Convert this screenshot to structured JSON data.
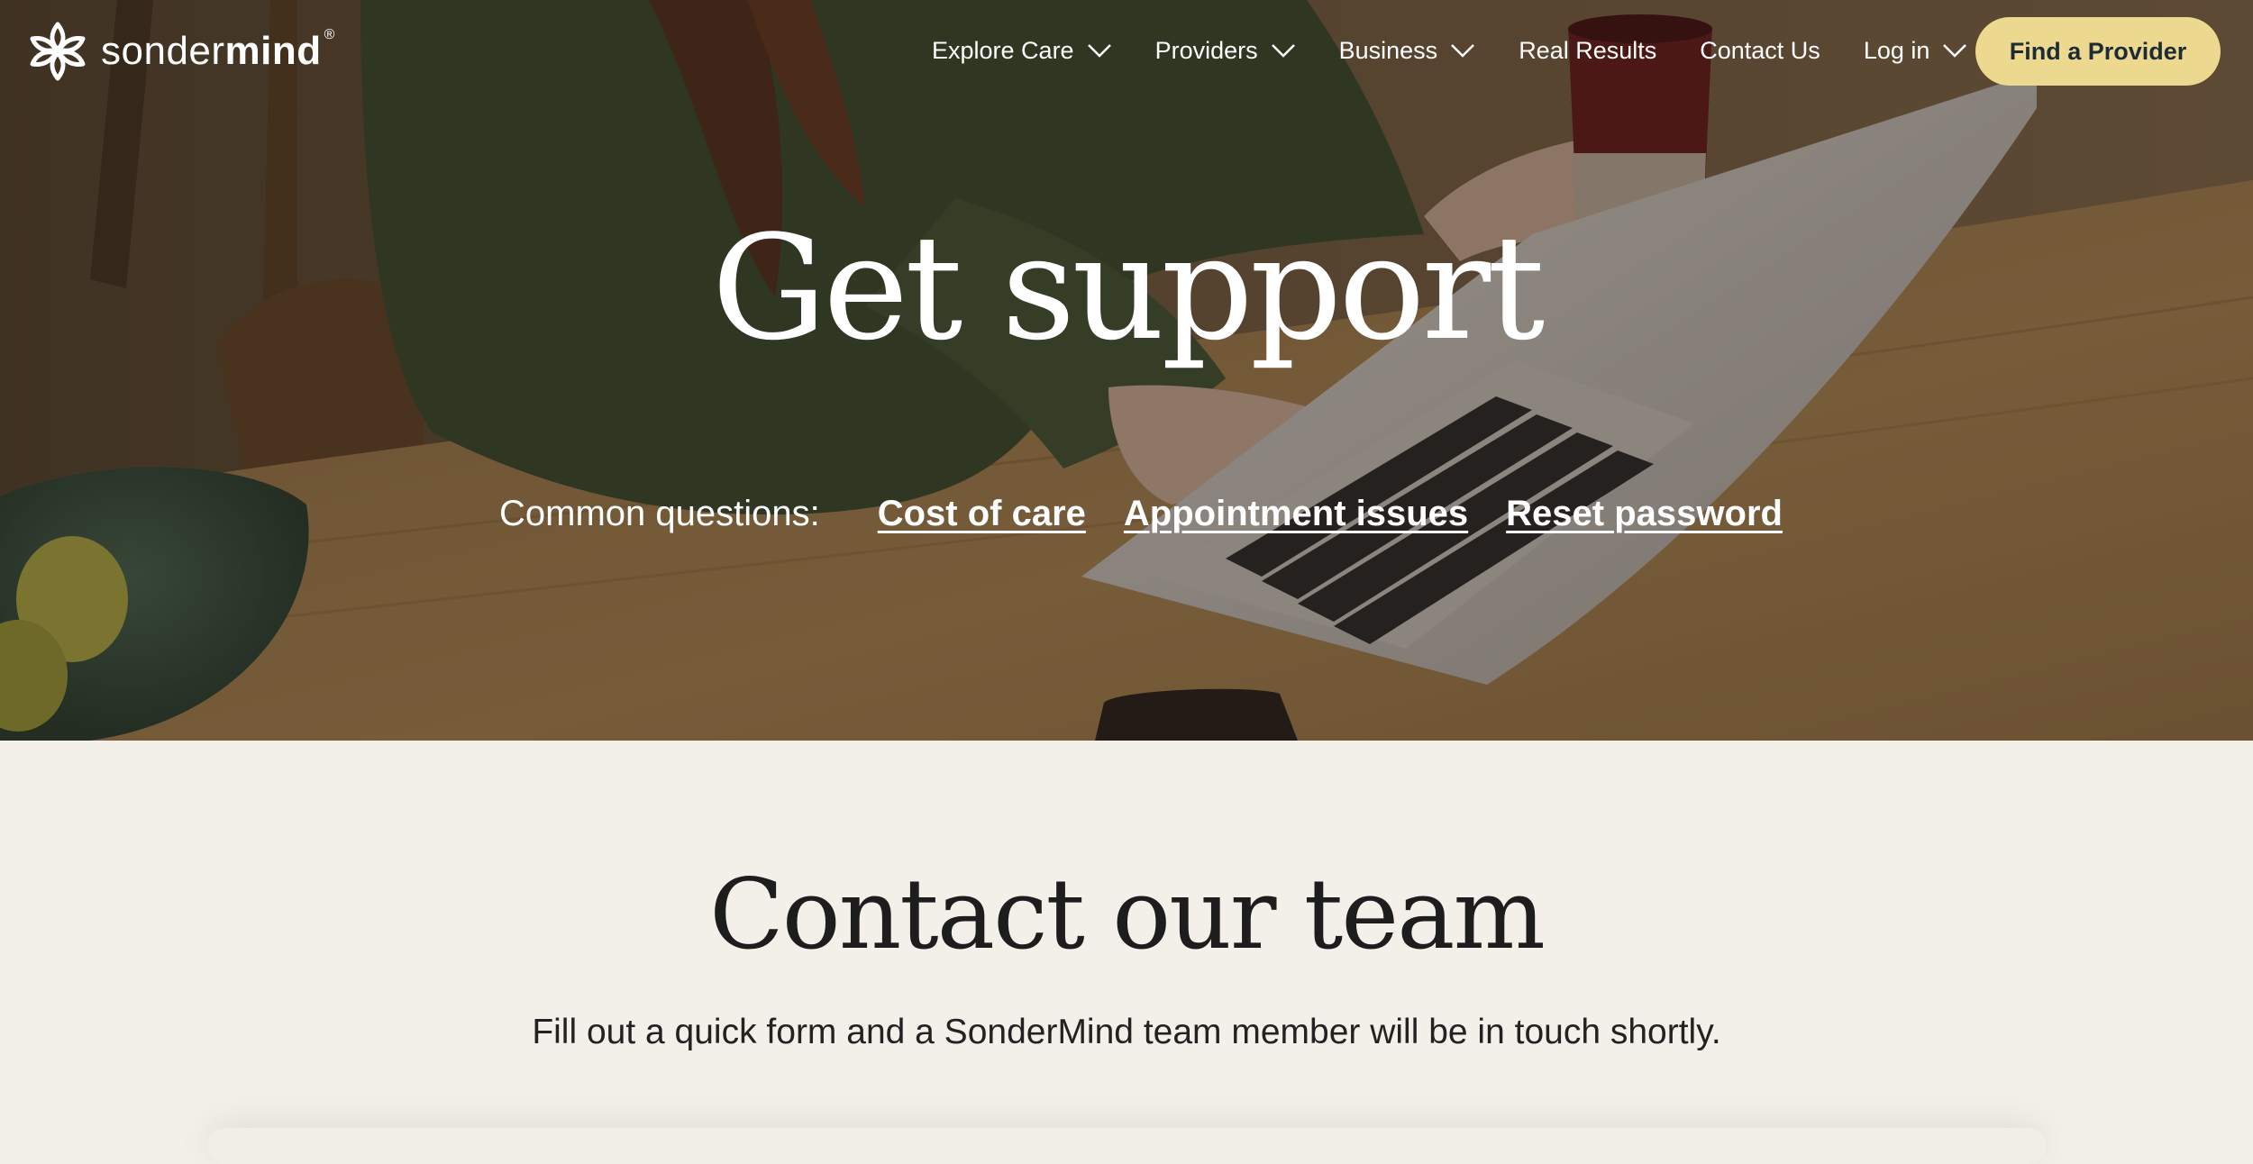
{
  "nav": {
    "logo": {
      "light": "sonder",
      "bold": "mind",
      "reg": "®"
    },
    "items": [
      {
        "label": "Explore Care",
        "has_dropdown": true,
        "icon": "chevron-down-icon"
      },
      {
        "label": "Providers",
        "has_dropdown": true,
        "icon": "chevron-down-icon"
      },
      {
        "label": "Business",
        "has_dropdown": true,
        "icon": "chevron-down-icon"
      },
      {
        "label": "Real Results",
        "has_dropdown": false
      },
      {
        "label": "Contact Us",
        "has_dropdown": false
      },
      {
        "label": "Log in",
        "has_dropdown": true,
        "icon": "chevron-down-icon"
      }
    ],
    "cta": "Find a Provider"
  },
  "hero": {
    "title": "Get support",
    "common_label": "Common questions:",
    "links": [
      "Cost of care",
      "Appointment issues",
      "Reset password"
    ]
  },
  "contact": {
    "title": "Contact our team",
    "subtitle": "Fill out a quick form and a SonderMind team member will be in touch shortly."
  },
  "colors": {
    "cta_bg": "#ecd98f",
    "cta_text": "#1c2b36",
    "page_bg": "#f3efe9",
    "text_dark": "#1d1d1d"
  }
}
